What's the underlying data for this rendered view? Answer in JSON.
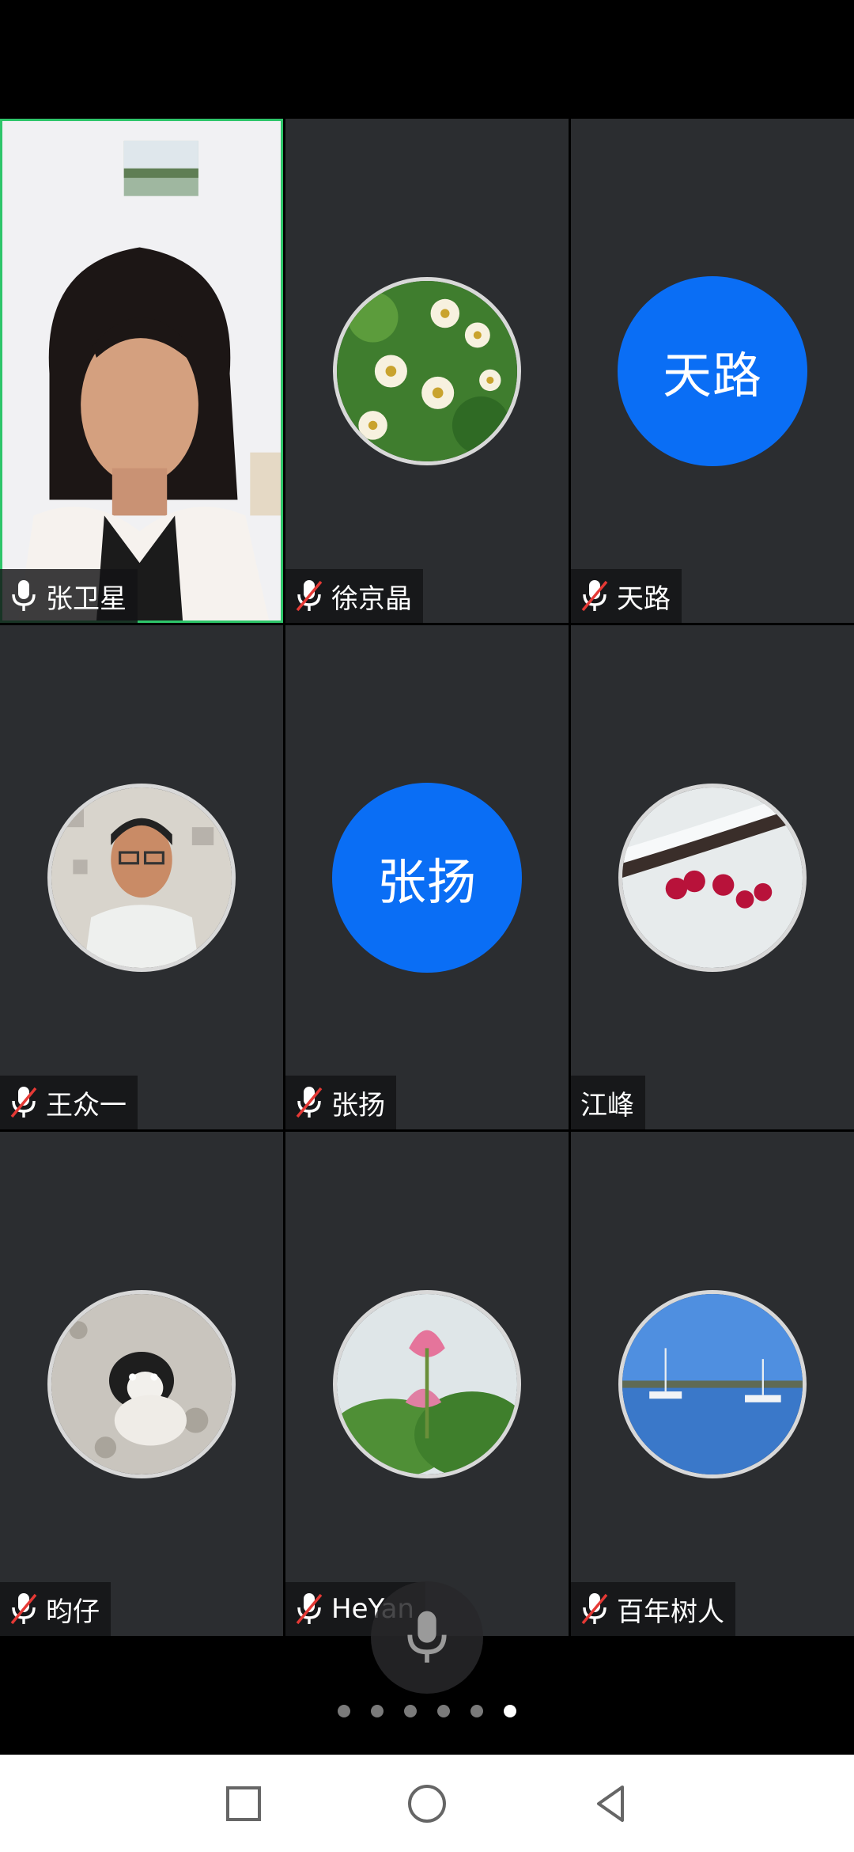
{
  "participants": [
    {
      "name": "张卫星",
      "muted": false,
      "type": "video",
      "active": true
    },
    {
      "name": "徐京晶",
      "muted": true,
      "type": "photo",
      "photo": "flower-daisies"
    },
    {
      "name": "天路",
      "muted": true,
      "type": "text",
      "initials": "天路"
    },
    {
      "name": "王众一",
      "muted": true,
      "type": "photo",
      "photo": "man-portrait"
    },
    {
      "name": "张扬",
      "muted": true,
      "type": "text",
      "initials": "张扬"
    },
    {
      "name": "江峰",
      "muted": null,
      "type": "photo",
      "photo": "plum-blossom-snow"
    },
    {
      "name": "昀仔",
      "muted": true,
      "type": "photo",
      "photo": "dog-snow"
    },
    {
      "name": "HeYan",
      "muted": true,
      "type": "photo",
      "photo": "lotus"
    },
    {
      "name": "百年树人",
      "muted": true,
      "type": "photo",
      "photo": "harbor-boats"
    }
  ],
  "pager": {
    "total": 6,
    "active_index": 5
  },
  "colors": {
    "tile_bg": "#2b2d30",
    "accent_blue": "#0a6ef5",
    "active_border": "#2ec56a",
    "muted_red": "#e53935"
  },
  "nav": {
    "icons": [
      "recents-square-icon",
      "home-circle-icon",
      "back-triangle-icon"
    ]
  }
}
